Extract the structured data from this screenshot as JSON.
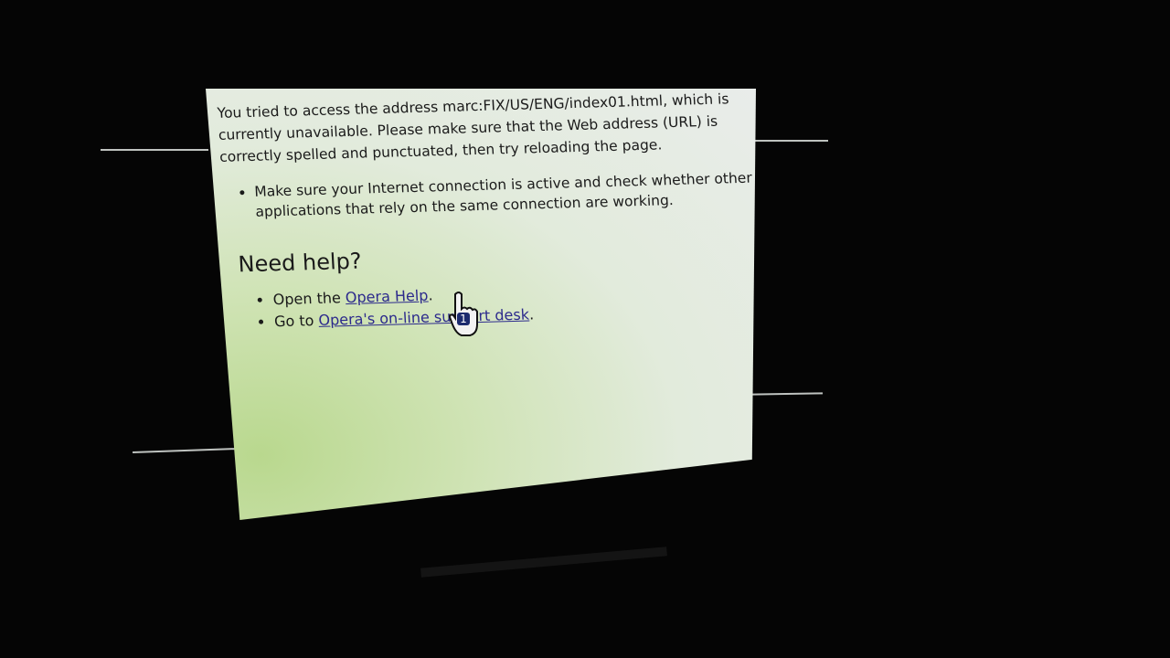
{
  "error_page": {
    "message": "You tried to access the address marc:FIX/US/ENG/index01.html, which is currently unavailable. Please make sure that the Web address (URL) is correctly spelled and punctuated, then try reloading the page.",
    "tips": [
      "Make sure your Internet connection is active and check whether other applications that rely on the same connection are working."
    ],
    "help_heading": "Need help?",
    "help_items": [
      {
        "prefix": "Open the ",
        "link": "Opera Help",
        "suffix": "."
      },
      {
        "prefix": "Go to ",
        "link": "Opera's on-line support desk",
        "suffix": "."
      }
    ]
  },
  "cursor": {
    "badge": "1",
    "icon": "hand-pointer-icon"
  }
}
